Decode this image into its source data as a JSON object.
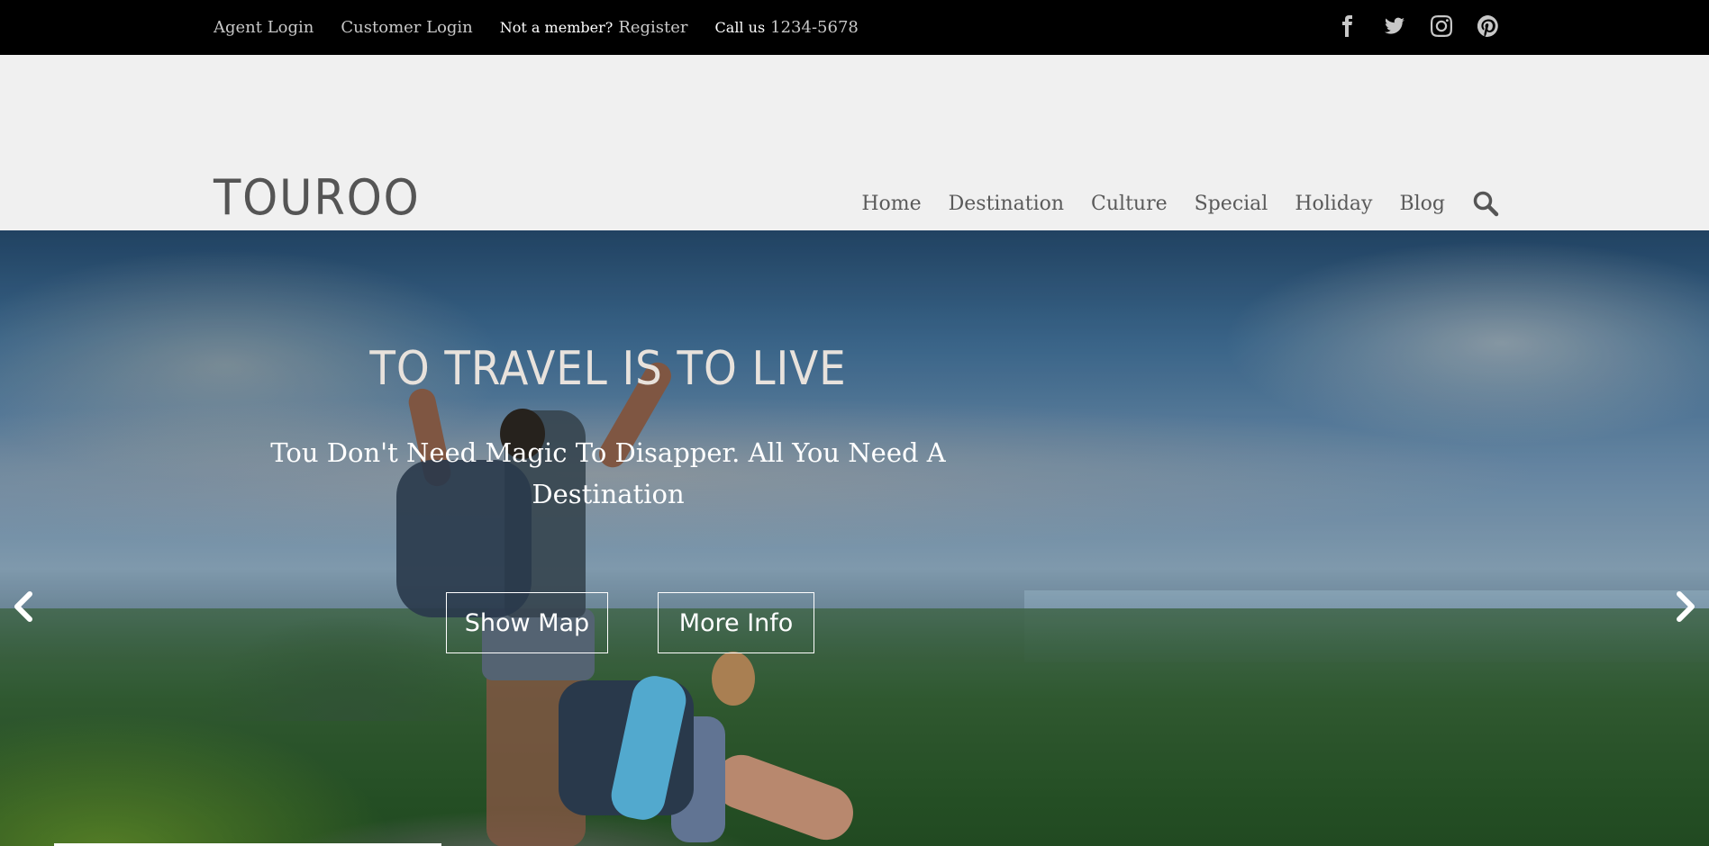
{
  "topbar": {
    "agent_login": "Agent Login",
    "customer_login": "Customer Login",
    "not_member": "Not a member?",
    "register": "Register",
    "call_us": "Call us",
    "phone": "1234-5678",
    "social_icons": [
      "facebook-icon",
      "twitter-icon",
      "instagram-icon",
      "pinterest-icon"
    ]
  },
  "header": {
    "logo": "TOUROO",
    "nav": [
      "Home",
      "Destination",
      "Culture",
      "Special",
      "Holiday",
      "Blog"
    ],
    "search_icon": "search-icon"
  },
  "hero": {
    "title": "TO TRAVEL IS TO LIVE",
    "subtitle": "Tou Don't Need Magic To Disapper. All You Need A Destination",
    "show_map": "Show Map",
    "more_info": "More Info"
  },
  "colors": {
    "topbar_bg": "#000000",
    "header_bg": "#f0f0f0",
    "nav_text": "#5a5a5a",
    "logo": "#555555"
  }
}
